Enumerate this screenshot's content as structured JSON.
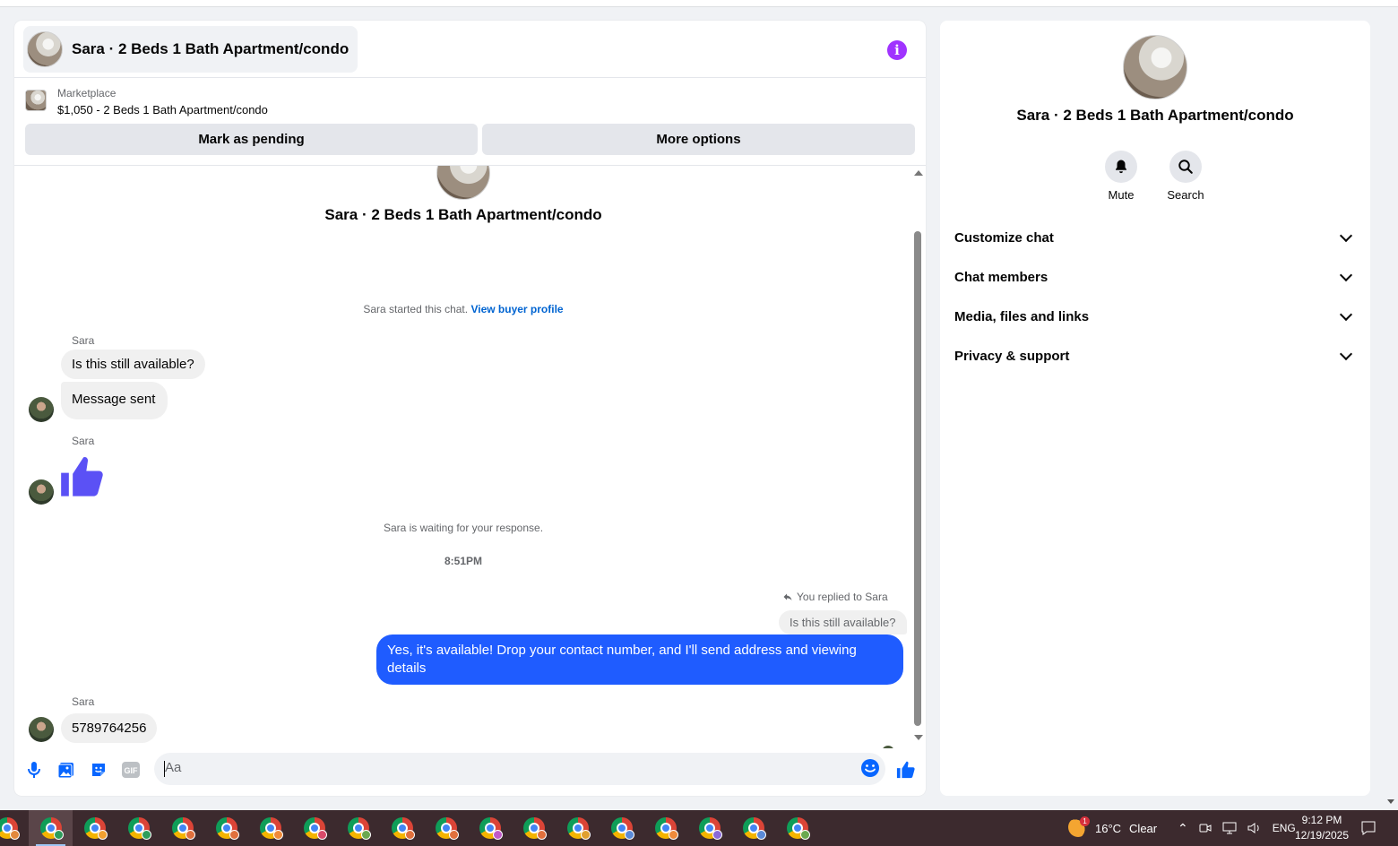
{
  "chat": {
    "title": "Sara · 2 Beds 1 Bath Apartment/condo",
    "info_icon": "info-icon",
    "marketplace": {
      "label": "Marketplace",
      "listing": "$1,050 - 2 Beds 1 Bath Apartment/condo",
      "mark_pending": "Mark as pending",
      "more_options": "More options"
    },
    "intro_name": "Sara · 2 Beds 1 Bath Apartment/condo",
    "started_text": "Sara started this chat.",
    "buyer_profile_link": "View buyer profile",
    "messages": {
      "sender1": "Sara",
      "msg1": "Is this still available?",
      "msg2": "Message sent",
      "sender2": "Sara",
      "waiting": "Sara is waiting for your response.",
      "time": "8:51PM",
      "reply_ref": "You replied to Sara",
      "reply_quote": "Is this still available?",
      "out_msg": "Yes, it's available! Drop your contact number, and I'll send address and viewing details",
      "sender3": "Sara",
      "msg3": "5789764256"
    },
    "composer": {
      "placeholder": "Aa"
    },
    "colors": {
      "accent": "#1f5cff",
      "like": "#5b51f5",
      "info": "#a033ff"
    }
  },
  "side": {
    "name": "Sara · 2 Beds 1 Bath Apartment/condo",
    "mute": "Mute",
    "search": "Search",
    "sections": [
      "Customize chat",
      "Chat members",
      "Media, files and links",
      "Privacy & support"
    ]
  },
  "taskbar": {
    "temp": "16°C",
    "weather": "Clear",
    "weather_badge": "1",
    "lang": "ENG",
    "time": "9:12 PM",
    "date": "12/19/2025",
    "chrome_count": 19
  }
}
